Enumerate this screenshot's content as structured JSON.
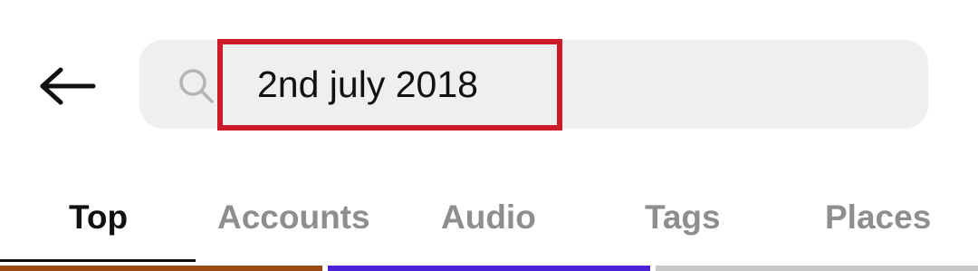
{
  "search": {
    "query": "2nd july 2018"
  },
  "tabs": [
    {
      "label": "Top",
      "active": true
    },
    {
      "label": "Accounts",
      "active": false
    },
    {
      "label": "Audio",
      "active": false
    },
    {
      "label": "Tags",
      "active": false
    },
    {
      "label": "Places",
      "active": false
    }
  ],
  "icons": {
    "back": "arrow-left-icon",
    "search": "search-icon"
  },
  "colors": {
    "search_bar_bg": "#efefef",
    "highlight": "#cc1a2b",
    "active_tab": "#111111",
    "inactive_tab": "#8e8e8e",
    "thumb_1": "#9a4a12",
    "thumb_2": "#4a22d8",
    "thumb_3": "#c8c8c8"
  }
}
